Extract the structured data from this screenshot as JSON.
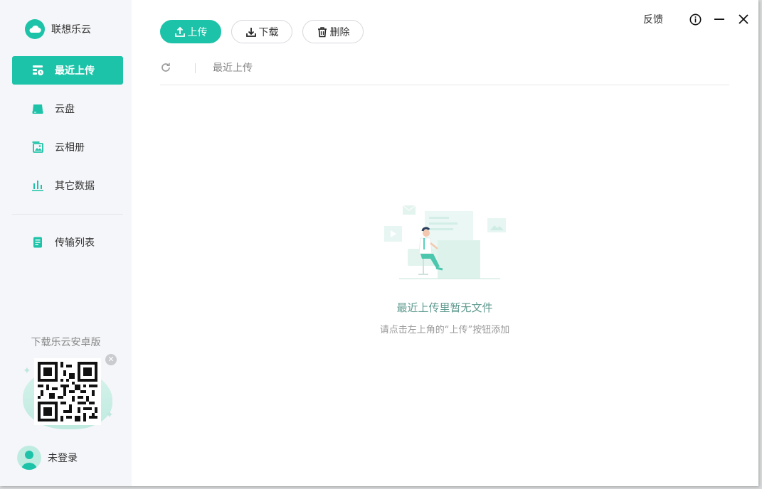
{
  "app": {
    "name": "联想乐云"
  },
  "sidebar": {
    "items": [
      {
        "label": "最近上传",
        "icon": "recent-upload-icon",
        "active": true
      },
      {
        "label": "云盘",
        "icon": "drive-icon",
        "active": false
      },
      {
        "label": "云相册",
        "icon": "album-icon",
        "active": false
      },
      {
        "label": "其它数据",
        "icon": "chart-icon",
        "active": false
      }
    ],
    "items2": [
      {
        "label": "传输列表",
        "icon": "transfer-list-icon"
      }
    ],
    "promo_title": "下载乐云安卓版",
    "user_name": "未登录"
  },
  "toolbar": {
    "upload_label": "上传",
    "download_label": "下载",
    "delete_label": "删除"
  },
  "window": {
    "feedback_label": "反馈"
  },
  "breadcrumb": {
    "current": "最近上传"
  },
  "empty_state": {
    "title": "最近上传里暂无文件",
    "subtitle": "请点击左上角的“上传”按钮添加"
  },
  "colors": {
    "accent": "#1dc3a8",
    "sidebar_bg": "#f5f6f9",
    "empty_title": "#5e9a8e"
  }
}
